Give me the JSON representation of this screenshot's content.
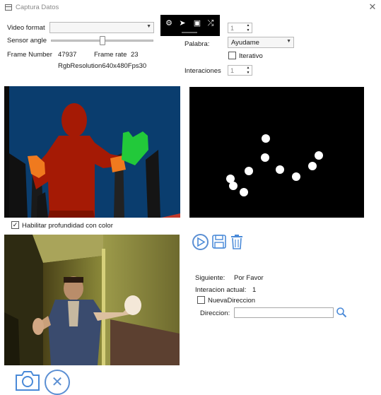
{
  "window": {
    "title": "Captura Datos",
    "close_symbol": "✕"
  },
  "left_panel": {
    "video_format_label": "Video format",
    "video_format_value": "",
    "sensor_angle_label": "Sensor angle",
    "frame_number_label": "Frame Number",
    "frame_number_value": "47937",
    "frame_rate_label": "Frame rate",
    "frame_rate_value": "23",
    "resolution_text": "RgbResolution640x480Fps30"
  },
  "toolbar": {
    "icons": [
      "settings-icon",
      "pointer-screen-icon",
      "frame-icon",
      "camera-transform-icon"
    ]
  },
  "right_panel": {
    "top_spinner_value": "1",
    "palabra_label": "Palabra:",
    "palabra_value": "Ayudame",
    "iterativo_label": "Iterativo",
    "iterativo_checked": false,
    "interaciones_label": "Interaciones",
    "interaciones_value": "1"
  },
  "depth_toggle": {
    "label": "Habilitar profundidad con color",
    "checked": true,
    "check_symbol": "✓"
  },
  "skeleton_view": {
    "background": "#000000",
    "joint_color": "#ffffff"
  },
  "info": {
    "siguiente_label": "Siguiente:",
    "siguiente_value": "Por Favor",
    "interacion_actual_label": "Interacion actual:",
    "interacion_actual_value": "1",
    "nueva_direccion_label": "NuevaDireccion",
    "nueva_direccion_checked": false,
    "direccion_label": "Direccion:",
    "direccion_value": ""
  },
  "colors": {
    "depth_bg": "#0a3d6e",
    "body_red": "#a51a05",
    "hand_green": "#22c93a",
    "hand_orange": "#f07a1e",
    "accent_blue": "#4a8ad8"
  }
}
